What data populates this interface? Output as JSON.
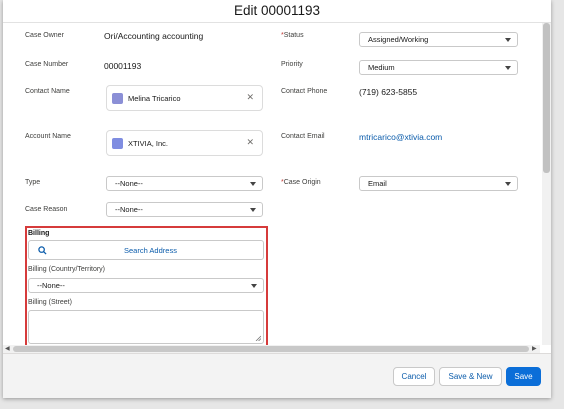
{
  "modal": {
    "title": "Edit 00001193"
  },
  "fields": {
    "case_owner": {
      "label": "Case Owner",
      "value": "Ori/Accounting accounting"
    },
    "status": {
      "label": "Status",
      "required_mark": "*",
      "value": "Assigned/Working"
    },
    "case_number": {
      "label": "Case Number",
      "value": "00001193"
    },
    "priority": {
      "label": "Priority",
      "value": "Medium"
    },
    "contact_name": {
      "label": "Contact Name",
      "value": "Melina Tricarico"
    },
    "contact_phone": {
      "label": "Contact Phone",
      "value": "(719) 623-5855"
    },
    "account_name": {
      "label": "Account Name",
      "value": "XTIVIA, Inc."
    },
    "contact_email": {
      "label": "Contact Email",
      "value": "mtricarico@xtivia.com"
    },
    "type": {
      "label": "Type",
      "value": "--None--"
    },
    "case_origin": {
      "label": "Case Origin",
      "required_mark": "*",
      "value": "Email"
    },
    "case_reason": {
      "label": "Case Reason",
      "value": "--None--"
    }
  },
  "billing": {
    "heading": "Billing",
    "search_placeholder": "Search Address",
    "country_label": "Billing (Country/Territory)",
    "country_value": "--None--",
    "street_label": "Billing (Street)",
    "street_value": ""
  },
  "footer": {
    "cancel": "Cancel",
    "save_new": "Save & New",
    "save": "Save"
  },
  "colors": {
    "brand": "#0b6ed8",
    "highlight": "#d63b3b",
    "required": "#c23934",
    "link": "#0b5cab"
  },
  "icons": {
    "contact": "contact-icon",
    "account": "account-icon",
    "search": "search-icon",
    "clear": "close-icon",
    "dropdown": "chevron-down-icon"
  }
}
